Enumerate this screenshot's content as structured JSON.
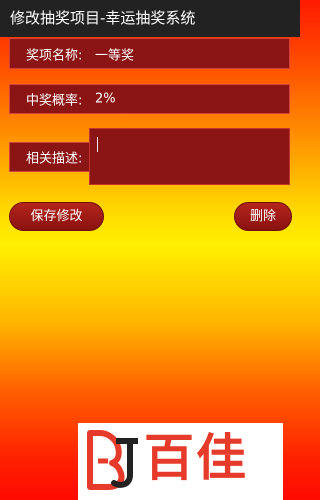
{
  "window": {
    "title": "修改抽奖项目-幸运抽奖系统"
  },
  "form": {
    "name_label": "奖项名称:",
    "name_value": "一等奖",
    "probability_label": "中奖概率:",
    "probability_value": "2%",
    "description_label": "相关描述:",
    "description_value": ""
  },
  "buttons": {
    "save_label": "保存修改",
    "delete_label": "删除"
  },
  "logo": {
    "text": "百佳",
    "mark_text": "BJ",
    "colors": {
      "red": "#e63a2a",
      "dark": "#222222"
    }
  },
  "colors": {
    "field_background": "#8b1414",
    "field_border": "#d2423a",
    "titlebar_background": "#222222"
  }
}
